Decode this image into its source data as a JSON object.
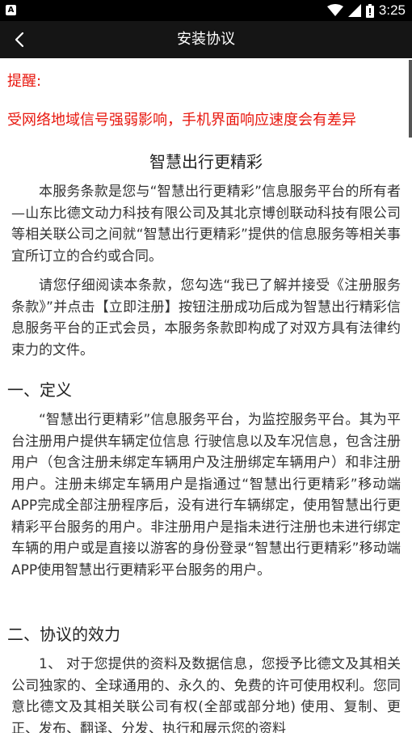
{
  "status_bar": {
    "time": "3:25",
    "icons": [
      "app-notification-icon",
      "wifi-icon",
      "cell-signal-icon",
      "battery-icon"
    ],
    "app_badge": "A"
  },
  "title_bar": {
    "back_icon": "chevron-left-icon",
    "title": "安装协议"
  },
  "notice": {
    "label": "提醒:",
    "text": "受网络地域信号强弱影响，手机界面响应速度会有差异",
    "color": "#e8170e"
  },
  "document": {
    "title": "智慧出行更精彩",
    "intro_paragraphs": [
      "本服务条款是您与“智慧出行更精彩”信息服务平台的所有者—山东比德文动力科技有限公司及其北京博创联动科技有限公司等相关联公司之间就“智慧出行更精彩”提供的信息服务等相关事宜所订立的合约或合同。",
      "请您仔细阅读本条款，您勾选“我已了解并接受《注册服务条款》”并点击【立即注册】按钮注册成功后成为智慧出行精彩信息服务平台的正式会员，本服务条款即构成了对双方具有法律约束力的文件。"
    ],
    "sections": [
      {
        "heading": "一、定义",
        "paragraphs": [
          "“智慧出行更精彩”信息服务平台，为监控服务平台。其为平台注册用户提供车辆定位信息 行驶信息以及车况信息，包含注册用户（包含注册未绑定车辆用户及注册绑定车辆用户）和非注册用户。注册未绑定车辆用户是指通过“智慧出行更精彩”移动端APP完成全部注册程序后，没有进行车辆绑定，使用智慧出行更精彩平台服务的用户。非注册用户是指未进行注册也未进行绑定车辆的用户或是直接以游客的身份登录“智慧出行更精彩”移动端APP使用智慧出行更精彩平台服务的用户。"
        ]
      },
      {
        "heading": "二、协议的效力",
        "paragraphs": [
          "1、 对于您提供的资料及数据信息，您授予比德文及其相关公司独家的、全球通用的、永久的、免费的许可使用权利。您同意比德文及其相关联公司有权(全部或部分地) 使用、复制、更正、发布、翻译、分发、执行和展示您的资料"
        ]
      }
    ]
  }
}
